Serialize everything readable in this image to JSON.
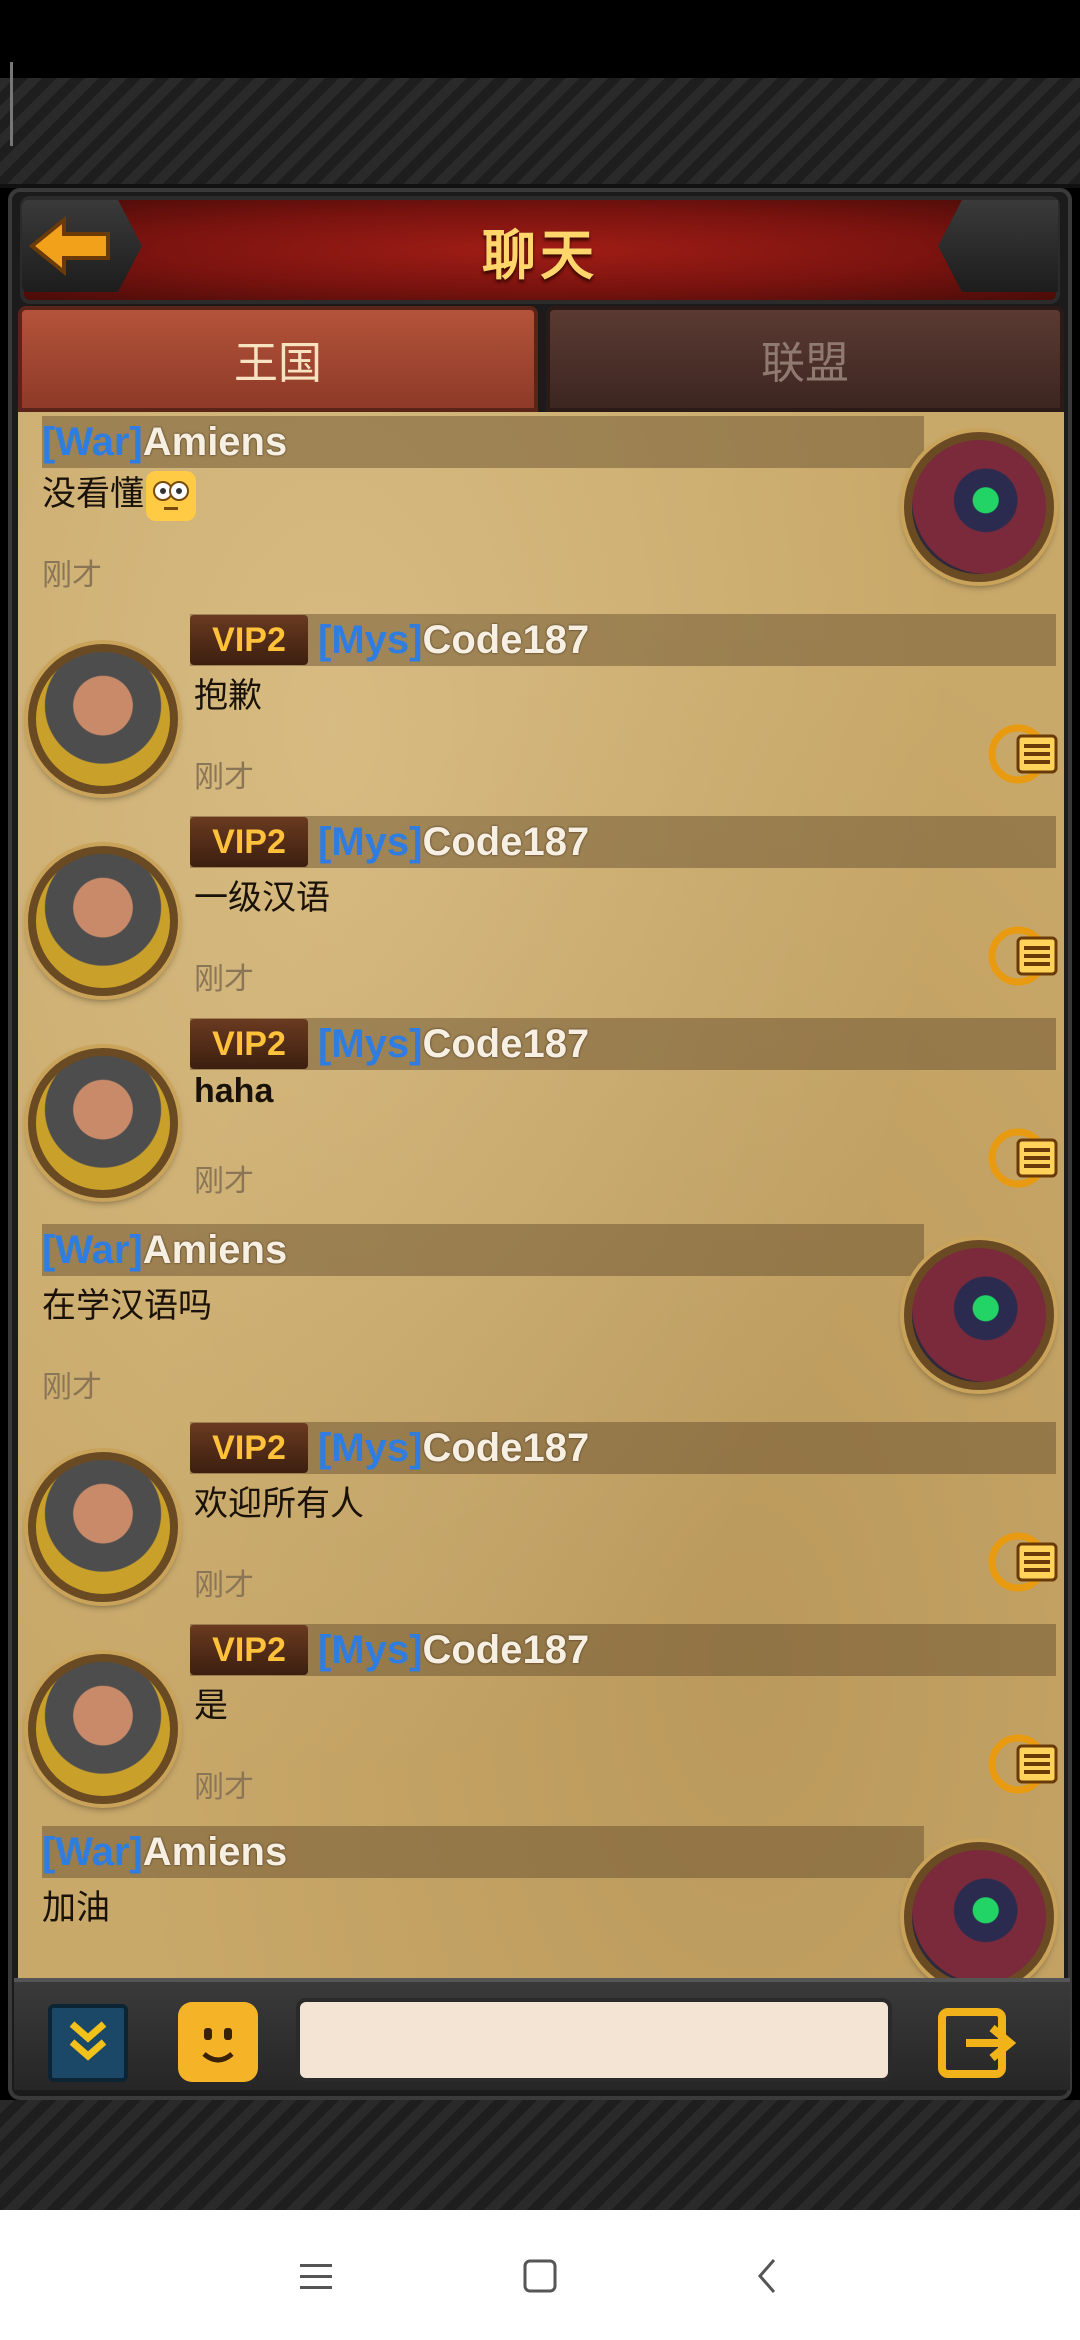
{
  "header": {
    "title": "聊天"
  },
  "tabs": [
    {
      "label": "王国",
      "active": true
    },
    {
      "label": "联盟",
      "active": false
    }
  ],
  "messages": [
    {
      "side": "right",
      "tag": "[War]",
      "name": "Amiens",
      "vip": "",
      "text": "没看懂",
      "emoji": true,
      "time": "刚才"
    },
    {
      "side": "left",
      "tag": "[Mys]",
      "name": "Code187",
      "vip": "VIP2",
      "text": "抱歉",
      "time": "刚才"
    },
    {
      "side": "left",
      "tag": "[Mys]",
      "name": "Code187",
      "vip": "VIP2",
      "text": "一级汉语",
      "time": "刚才"
    },
    {
      "side": "left",
      "tag": "[Mys]",
      "name": "Code187",
      "vip": "VIP2",
      "text": "haha",
      "time": "刚才"
    },
    {
      "side": "right",
      "tag": "[War]",
      "name": "Amiens",
      "vip": "",
      "text": "在学汉语吗",
      "time": "刚才"
    },
    {
      "side": "left",
      "tag": "[Mys]",
      "name": "Code187",
      "vip": "VIP2",
      "text": "欢迎所有人",
      "time": "刚才"
    },
    {
      "side": "left",
      "tag": "[Mys]",
      "name": "Code187",
      "vip": "VIP2",
      "text": "是",
      "time": "刚才"
    },
    {
      "side": "right",
      "tag": "[War]",
      "name": "Amiens",
      "vip": "",
      "text": "加油",
      "time": "刚才"
    }
  ],
  "input": {
    "value": "",
    "placeholder": ""
  },
  "colors": {
    "tag_blue": "#2f7de0",
    "vip_gold": "#ffc23a",
    "title_red": "#a11d16",
    "parchment": "#c9a96a"
  },
  "icons": [
    "back-arrow-icon",
    "translate-icon",
    "scroll-down-icon",
    "emoji-icon",
    "send-icon",
    "menu-icon",
    "home-icon",
    "back-icon"
  ]
}
